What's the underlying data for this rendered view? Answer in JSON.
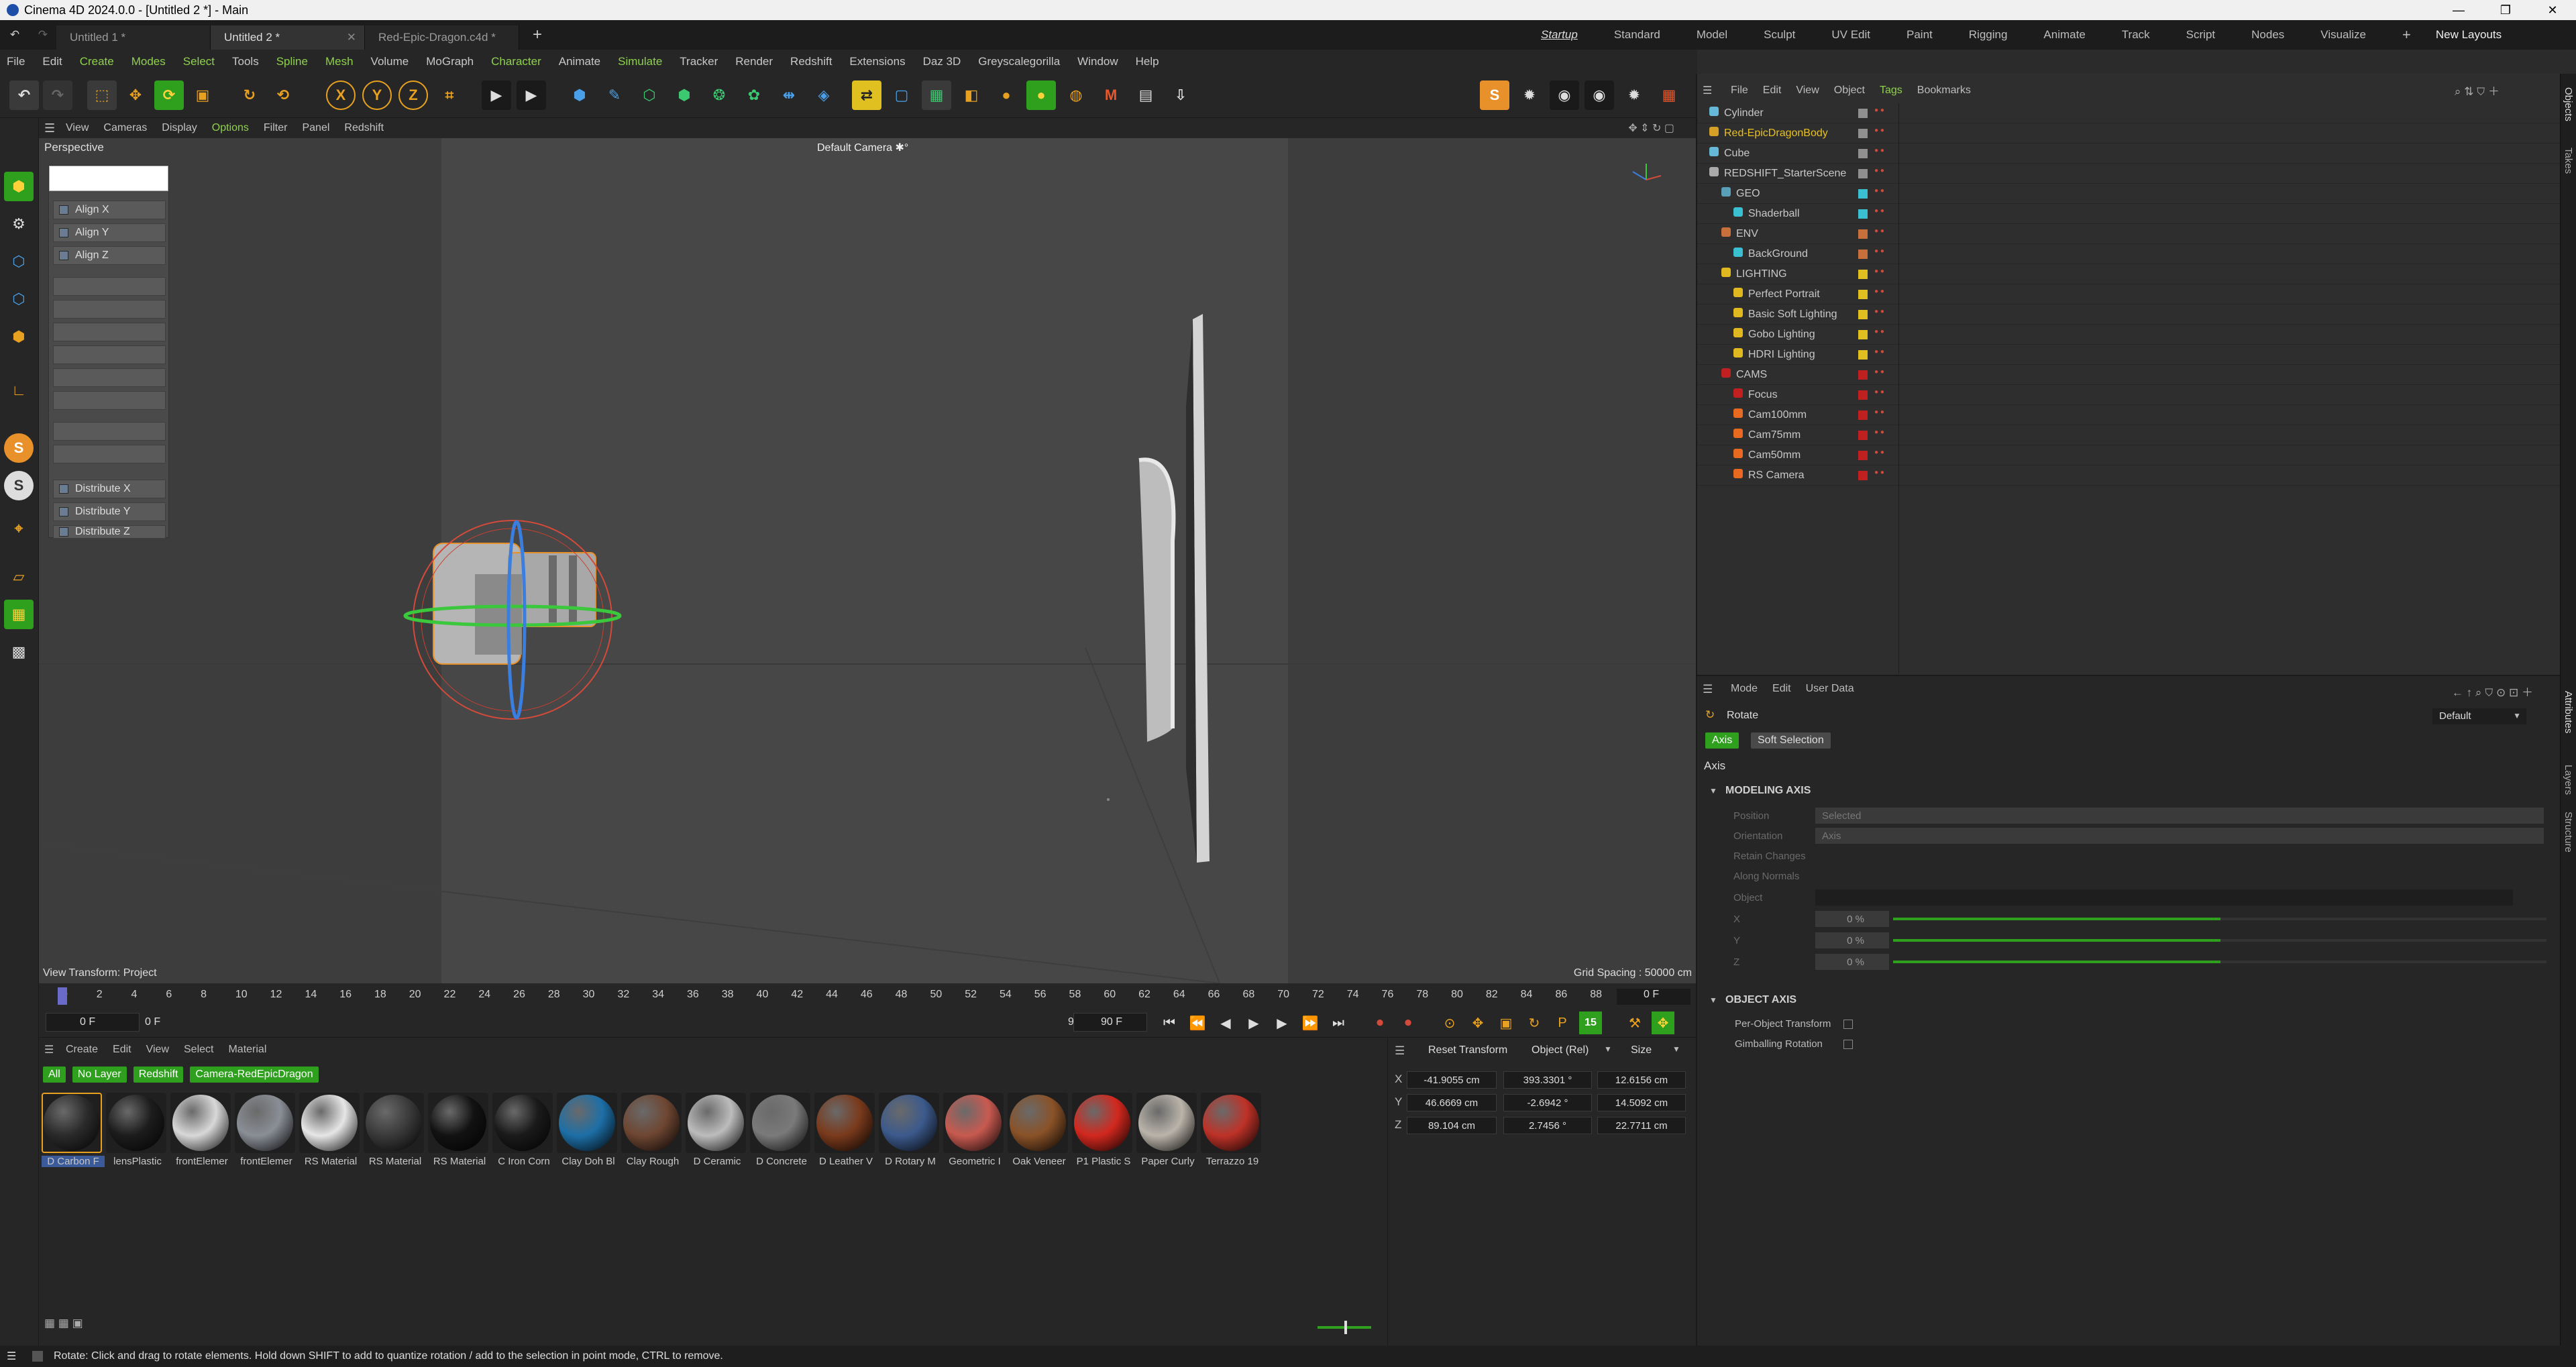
{
  "title": "Cinema 4D 2024.0.0 - [Untitled 2 *] - Main",
  "window_controls": [
    "—",
    "❐",
    "✕"
  ],
  "doc_tabs": [
    {
      "label": "Untitled 1 *"
    },
    {
      "label": "Untitled 2 *"
    },
    {
      "label": "Red-Epic-Dragon.c4d *"
    }
  ],
  "new_tab": "+",
  "layouts": [
    "Startup",
    "Standard",
    "Model",
    "Sculpt",
    "UV Edit",
    "Paint",
    "Rigging",
    "Animate",
    "Track",
    "Script",
    "Nodes",
    "Visualize"
  ],
  "new_layouts": "New Layouts",
  "menu": [
    "File",
    "Edit",
    "Create",
    "Modes",
    "Select",
    "Tools",
    "Spline",
    "Mesh",
    "Volume",
    "MoGraph",
    "Character",
    "Animate",
    "Simulate",
    "Tracker",
    "Render",
    "Redshift",
    "Extensions",
    "Daz 3D",
    "Greyscalegorilla",
    "Window",
    "Help"
  ],
  "viewport": {
    "menu": [
      "View",
      "Cameras",
      "Display",
      "Options",
      "Filter",
      "Panel",
      "Redshift"
    ],
    "label": "Perspective",
    "camera": "Default Camera ✱°",
    "view_transform": "View Transform: Project",
    "grid_spacing": "Grid Spacing : 50000 cm"
  },
  "align_panel": {
    "items": [
      "Align X",
      "Align Y",
      "Align Z",
      "Distribute X",
      "Distribute Y",
      "Distribute Z"
    ]
  },
  "timeline": {
    "ticks": [
      "0",
      "2",
      "4",
      "6",
      "8",
      "10",
      "12",
      "14",
      "16",
      "18",
      "20",
      "22",
      "24",
      "26",
      "28",
      "30",
      "32",
      "34",
      "36",
      "38",
      "40",
      "42",
      "44",
      "46",
      "48",
      "50",
      "52",
      "54",
      "56",
      "58",
      "60",
      "62",
      "64",
      "66",
      "68",
      "70",
      "72",
      "74",
      "76",
      "78",
      "80",
      "82",
      "84",
      "86",
      "88",
      "90"
    ],
    "current": "0 F",
    "start": "0 F",
    "start2": "0 F",
    "end": "90 F",
    "end2": "90 F",
    "fps": "15"
  },
  "materials": {
    "menu": [
      "Create",
      "Edit",
      "View",
      "Select",
      "Material"
    ],
    "filters": [
      "All",
      "No Layer",
      "Redshift",
      "Camera-RedEpicDragon"
    ],
    "items": [
      {
        "label": "D Carbon F",
        "color": "#2a2a2a"
      },
      {
        "label": "lensPlastic",
        "color": "#1c1c1c"
      },
      {
        "label": "frontElemer",
        "color": "#d8d8d8"
      },
      {
        "label": "frontElemer",
        "color": "#8a8e96"
      },
      {
        "label": "RS Material",
        "color": "#e6e6e6"
      },
      {
        "label": "RS Material",
        "color": "#3a3a3a"
      },
      {
        "label": "RS Material",
        "color": "#121212"
      },
      {
        "label": "C Iron Corn",
        "color": "#1a1a1a"
      },
      {
        "label": "Clay Doh Bl",
        "color": "#1d6fa7"
      },
      {
        "label": "Clay Rough",
        "color": "#6e4632"
      },
      {
        "label": "D Ceramic",
        "color": "#bcbcbc"
      },
      {
        "label": "D Concrete",
        "color": "#7a7a7a"
      },
      {
        "label": "D Leather V",
        "color": "#7a3a1c"
      },
      {
        "label": "D Rotary M",
        "color": "#3c5a8c"
      },
      {
        "label": "Geometric I",
        "color": "#c85a50"
      },
      {
        "label": "Oak Veneer",
        "color": "#8a5228"
      },
      {
        "label": "P1 Plastic S",
        "color": "#d2281e"
      },
      {
        "label": "Paper Curly",
        "color": "#bab4aa"
      },
      {
        "label": "Terrazzo 19",
        "color": "#be3228"
      }
    ]
  },
  "coords": {
    "reset": "Reset Transform",
    "mode": "Object (Rel)",
    "size": "Size",
    "rows": [
      {
        "axis": "X",
        "p": "-41.9055 cm",
        "r": "393.3301 °",
        "s": "12.6156 cm"
      },
      {
        "axis": "Y",
        "p": "46.6669 cm",
        "r": "-2.6942 °",
        "s": "14.5092 cm"
      },
      {
        "axis": "Z",
        "p": "89.104 cm",
        "r": "2.7456 °",
        "s": "22.7711 cm"
      }
    ]
  },
  "objects": {
    "menu": [
      "File",
      "Edit",
      "View",
      "Object",
      "Tags",
      "Bookmarks"
    ],
    "rows": [
      {
        "name": "Cylinder",
        "indent": 0,
        "color": "#66b8d8",
        "sw": "#909090",
        "hl": false
      },
      {
        "name": "Red-EpicDragonBody",
        "indent": 0,
        "color": "#d4a026",
        "sw": "#909090",
        "hl": true
      },
      {
        "name": "Cube",
        "indent": 0,
        "color": "#66b8d8",
        "sw": "#909090",
        "hl": false
      },
      {
        "name": "REDSHIFT_StarterScene",
        "indent": 0,
        "color": "#aaaaaa",
        "sw": "#909090",
        "hl": false
      },
      {
        "name": "GEO",
        "indent": 1,
        "color": "#5a9fb8",
        "sw": "#3ac0d0",
        "hl": false
      },
      {
        "name": "Shaderball",
        "indent": 2,
        "color": "#3ac0d0",
        "sw": "#3ac0d0",
        "hl": false
      },
      {
        "name": "ENV",
        "indent": 1,
        "color": "#c8703c",
        "sw": "#c8703c",
        "hl": false
      },
      {
        "name": "BackGround",
        "indent": 2,
        "color": "#3ac0d0",
        "sw": "#c8703c",
        "hl": false
      },
      {
        "name": "LIGHTING",
        "indent": 1,
        "color": "#e0b820",
        "sw": "#e0c020",
        "hl": false
      },
      {
        "name": "Perfect Portrait",
        "indent": 2,
        "color": "#e0b820",
        "sw": "#e0c020",
        "hl": false
      },
      {
        "name": "Basic Soft Lighting",
        "indent": 2,
        "color": "#e0b820",
        "sw": "#e0c020",
        "hl": false
      },
      {
        "name": "Gobo Lighting",
        "indent": 2,
        "color": "#e0b820",
        "sw": "#e0c020",
        "hl": false
      },
      {
        "name": "HDRI Lighting",
        "indent": 2,
        "color": "#e0b820",
        "sw": "#e0c020",
        "hl": false
      },
      {
        "name": "CAMS",
        "indent": 1,
        "color": "#c02020",
        "sw": "#c02020",
        "hl": false
      },
      {
        "name": "Focus",
        "indent": 2,
        "color": "#c02020",
        "sw": "#c02020",
        "hl": false
      },
      {
        "name": "Cam100mm",
        "indent": 2,
        "color": "#e86a20",
        "sw": "#c02020",
        "hl": false
      },
      {
        "name": "Cam75mm",
        "indent": 2,
        "color": "#e86a20",
        "sw": "#c02020",
        "hl": false
      },
      {
        "name": "Cam50mm",
        "indent": 2,
        "color": "#e86a20",
        "sw": "#c02020",
        "hl": false
      },
      {
        "name": "RS Camera",
        "indent": 2,
        "color": "#e86a20",
        "sw": "#c02020",
        "hl": false
      }
    ]
  },
  "attributes": {
    "menu": [
      "Mode",
      "Edit",
      "User Data"
    ],
    "tool": "Rotate",
    "preset": "Default",
    "tabs": [
      "Axis",
      "Soft Selection"
    ],
    "group": "Axis",
    "section1": "MODELING AXIS",
    "props": [
      {
        "label": "Position",
        "value": "Selected"
      },
      {
        "label": "Orientation",
        "value": "Axis"
      },
      {
        "label": "Retain Changes",
        "value": ""
      },
      {
        "label": "Along Normals",
        "value": ""
      },
      {
        "label": "Object",
        "value": ""
      },
      {
        "label": "X",
        "value": "0 %"
      },
      {
        "label": "Y",
        "value": "0 %"
      },
      {
        "label": "Z",
        "value": "0 %"
      }
    ],
    "section2": "OBJECT AXIS",
    "checks": [
      "Per-Object Transform",
      "Gimballing Rotation"
    ]
  },
  "right_tabs": [
    "Objects",
    "Takes",
    "Attributes",
    "Layers",
    "Structure"
  ],
  "status": "Rotate: Click and drag to rotate elements. Hold down SHIFT to add to quantize rotation / add to the selection in point mode, CTRL to remove."
}
